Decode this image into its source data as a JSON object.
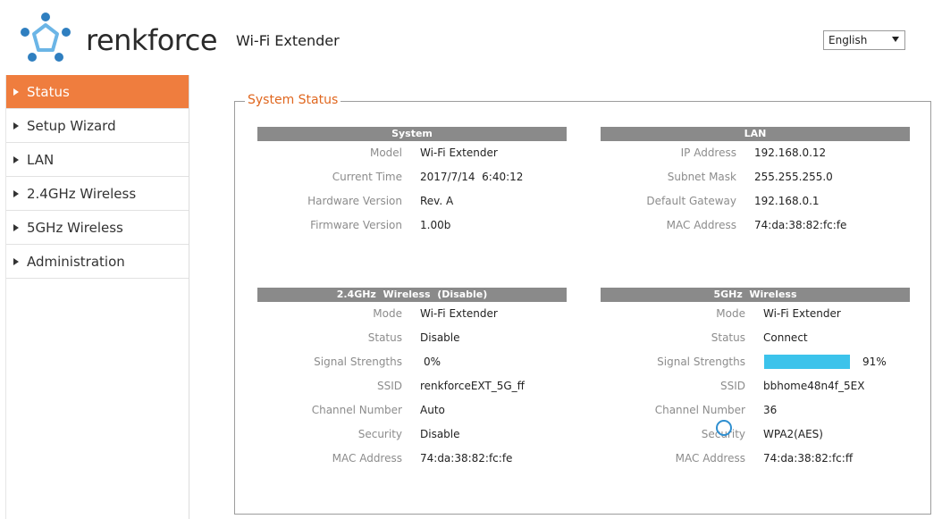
{
  "header": {
    "brand": "renkforce",
    "product": "Wi-Fi Extender",
    "language": "English"
  },
  "sidebar": {
    "items": [
      {
        "label": "Status",
        "active": true
      },
      {
        "label": "Setup Wizard",
        "active": false
      },
      {
        "label": "LAN",
        "active": false
      },
      {
        "label": "2.4GHz Wireless",
        "active": false
      },
      {
        "label": "5GHz Wireless",
        "active": false
      },
      {
        "label": "Administration",
        "active": false
      }
    ]
  },
  "status": {
    "legend": "System Status",
    "system": {
      "title": "System",
      "rows": [
        {
          "label": "Model",
          "value": "Wi-Fi Extender"
        },
        {
          "label": "Current Time",
          "value": "2017/7/14  6:40:12"
        },
        {
          "label": "Hardware Version",
          "value": "Rev. A"
        },
        {
          "label": "Firmware Version",
          "value": "1.00b"
        }
      ]
    },
    "lan": {
      "title": "LAN",
      "rows": [
        {
          "label": "IP Address",
          "value": "192.168.0.12"
        },
        {
          "label": "Subnet Mask",
          "value": "255.255.255.0"
        },
        {
          "label": "Default Gateway",
          "value": "192.168.0.1"
        },
        {
          "label": "MAC Address",
          "value": "74:da:38:82:fc:fe"
        }
      ]
    },
    "wireless24": {
      "title": "2.4GHz  Wireless  (Disable)",
      "rows": [
        {
          "label": "Mode",
          "value": "Wi-Fi Extender"
        },
        {
          "label": "Status",
          "value": "Disable"
        },
        {
          "label": "Signal Strengths",
          "value": "0%"
        },
        {
          "label": "SSID",
          "value": "renkforceEXT_5G_ff"
        },
        {
          "label": "Channel Number",
          "value": "Auto"
        },
        {
          "label": "Security",
          "value": "Disable"
        },
        {
          "label": "MAC Address",
          "value": "74:da:38:82:fc:fe"
        }
      ]
    },
    "wireless5": {
      "title": "5GHz  Wireless",
      "signal_fraction": 0.91,
      "signal_color": "#3cc3eb",
      "rows": [
        {
          "label": "Mode",
          "value": "Wi-Fi Extender"
        },
        {
          "label": "Status",
          "value": "Connect"
        },
        {
          "label": "Signal Strengths",
          "value": "91%"
        },
        {
          "label": "SSID",
          "value": "bbhome48n4f_5EX"
        },
        {
          "label": "Channel Number",
          "value": "36"
        },
        {
          "label": "Security",
          "value": "WPA2(AES)"
        },
        {
          "label": "MAC Address",
          "value": "74:da:38:82:fc:ff"
        }
      ]
    }
  },
  "colors": {
    "accent": "#ef7d3e",
    "legend": "#e0671f",
    "panel_header": "#8a8a8a"
  }
}
